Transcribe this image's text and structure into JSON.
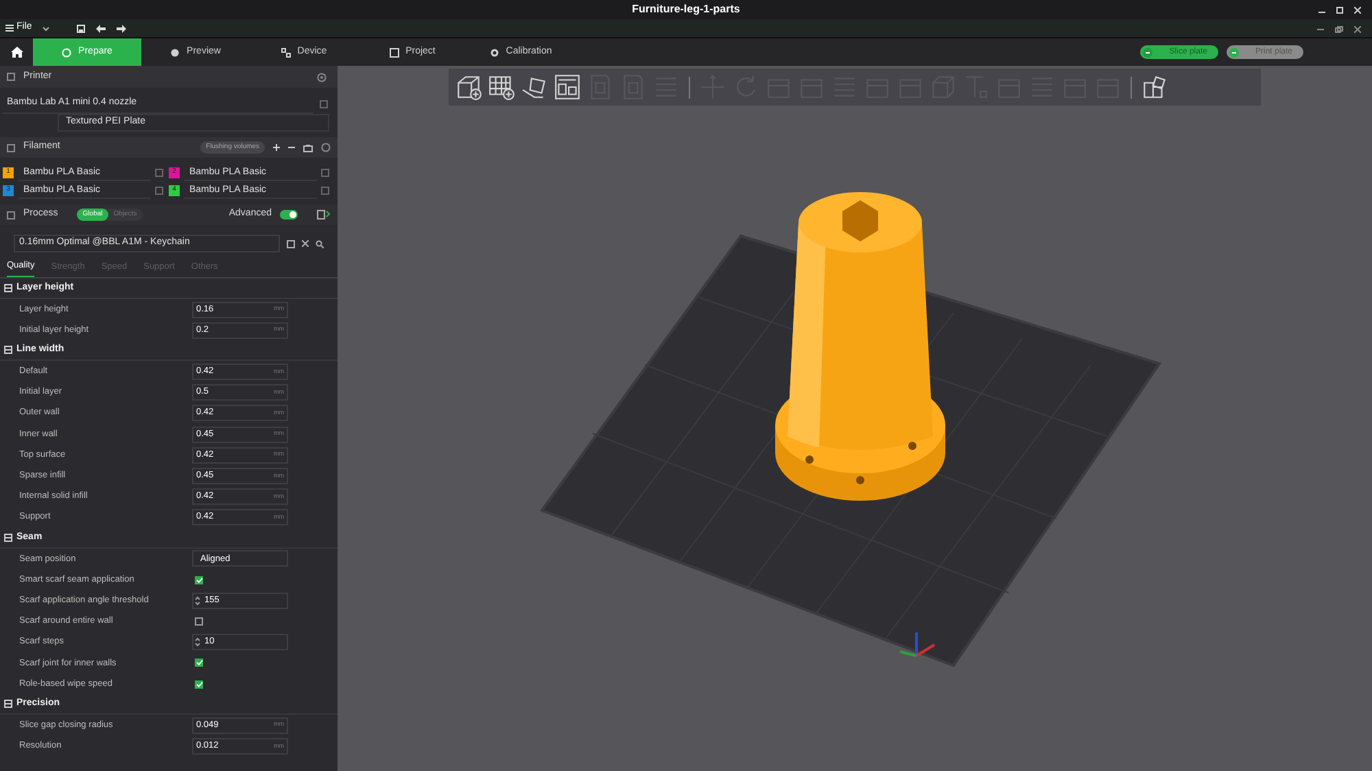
{
  "window": {
    "title": "Furniture-leg-1-parts"
  },
  "menu": {
    "file": "File"
  },
  "tabs": [
    {
      "label": "Prepare",
      "selected": true,
      "kind": "prepare"
    },
    {
      "label": "Preview",
      "selected": false,
      "kind": "preview"
    },
    {
      "label": "Device",
      "selected": false,
      "kind": "device"
    },
    {
      "label": "Project",
      "selected": false,
      "kind": "project"
    },
    {
      "label": "Calibration",
      "selected": false,
      "kind": "calibration"
    }
  ],
  "actions": [
    {
      "label": "Slice plate",
      "disabled": false
    },
    {
      "label": "Print plate",
      "disabled": true
    }
  ],
  "toolbar": [
    {
      "kind": "cube-plus",
      "disabled": false
    },
    {
      "kind": "grid-plus",
      "disabled": false
    },
    {
      "kind": "arrange",
      "disabled": false
    },
    {
      "kind": "layout",
      "disabled": false
    },
    {
      "kind": "page",
      "disabled": true
    },
    {
      "kind": "page",
      "disabled": true
    },
    {
      "kind": "lines",
      "disabled": true
    },
    {
      "kind": "sep"
    },
    {
      "kind": "move",
      "disabled": true
    },
    {
      "kind": "rotate",
      "disabled": true
    },
    {
      "kind": "square",
      "disabled": true
    },
    {
      "kind": "square",
      "disabled": true
    },
    {
      "kind": "lines",
      "disabled": true
    },
    {
      "kind": "square",
      "disabled": true
    },
    {
      "kind": "square",
      "disabled": true
    },
    {
      "kind": "cube",
      "disabled": true
    },
    {
      "kind": "text",
      "disabled": true
    },
    {
      "kind": "square",
      "disabled": true
    },
    {
      "kind": "lines",
      "disabled": true
    },
    {
      "kind": "square",
      "disabled": true
    },
    {
      "kind": "square",
      "disabled": true
    },
    {
      "kind": "sep"
    },
    {
      "kind": "puzzle",
      "disabled": false
    }
  ],
  "printer": {
    "title": "Printer",
    "model": "Bambu Lab A1 mini 0.4 nozzle",
    "plate": "Textured PEI Plate"
  },
  "filament": {
    "title": "Filament",
    "flushing": "Flushing volumes",
    "items": [
      {
        "number": "1",
        "color": "#f5a300",
        "name": "Bambu PLA Basic"
      },
      {
        "number": "2",
        "color": "#e0149a",
        "name": "Bambu PLA Basic"
      },
      {
        "number": "3",
        "color": "#1e88d8",
        "name": "Bambu PLA Basic"
      },
      {
        "number": "4",
        "color": "#2ecc40",
        "name": "Bambu PLA Basic"
      }
    ]
  },
  "process": {
    "title": "Process",
    "scopes": [
      {
        "label": "Global",
        "selected": true
      },
      {
        "label": "Objects",
        "selected": false
      }
    ],
    "advanced_label": "Advanced",
    "advanced": true,
    "preset": "0.16mm Optimal @BBL A1M - Keychain",
    "tabs": [
      {
        "label": "Quality",
        "selected": true
      },
      {
        "label": "Strength",
        "selected": false
      },
      {
        "label": "Speed",
        "selected": false
      },
      {
        "label": "Support",
        "selected": false
      },
      {
        "label": "Others",
        "selected": false
      }
    ]
  },
  "sections": [
    {
      "title": "Layer height",
      "rows": [
        {
          "kind": "input",
          "label": "Layer height",
          "value": "0.16",
          "unit": "mm"
        },
        {
          "kind": "input",
          "label": "Initial layer height",
          "value": "0.2",
          "unit": "mm"
        }
      ]
    },
    {
      "title": "Line width",
      "rows": [
        {
          "kind": "input",
          "label": "Default",
          "value": "0.42",
          "unit": "mm"
        },
        {
          "kind": "input",
          "label": "Initial layer",
          "value": "0.5",
          "unit": "mm"
        },
        {
          "kind": "input",
          "label": "Outer wall",
          "value": "0.42",
          "unit": "mm"
        },
        {
          "kind": "input",
          "label": "Inner wall",
          "value": "0.45",
          "unit": "mm"
        },
        {
          "kind": "input",
          "label": "Top surface",
          "value": "0.42",
          "unit": "mm"
        },
        {
          "kind": "input",
          "label": "Sparse infill",
          "value": "0.45",
          "unit": "mm"
        },
        {
          "kind": "input",
          "label": "Internal solid infill",
          "value": "0.42",
          "unit": "mm"
        },
        {
          "kind": "input",
          "label": "Support",
          "value": "0.42",
          "unit": "mm"
        }
      ]
    },
    {
      "title": "Seam",
      "rows": [
        {
          "kind": "dropdown",
          "label": "Seam position",
          "value": "Aligned"
        },
        {
          "kind": "checkbox",
          "label": "Smart scarf seam application",
          "checked": true
        },
        {
          "kind": "spinner",
          "label": "Scarf application angle threshold",
          "value": "155"
        },
        {
          "kind": "checkbox",
          "label": "Scarf around entire wall",
          "checked": false
        },
        {
          "kind": "spinner",
          "label": "Scarf steps",
          "value": "10"
        },
        {
          "kind": "checkbox",
          "label": "Scarf joint for inner walls",
          "checked": true
        },
        {
          "kind": "checkbox",
          "label": "Role-based wipe speed",
          "checked": true
        }
      ]
    },
    {
      "title": "Precision",
      "rows": [
        {
          "kind": "input",
          "label": "Slice gap closing radius",
          "value": "0.049",
          "unit": "mm"
        },
        {
          "kind": "input",
          "label": "Resolution",
          "value": "0.012",
          "unit": "mm"
        }
      ]
    }
  ]
}
